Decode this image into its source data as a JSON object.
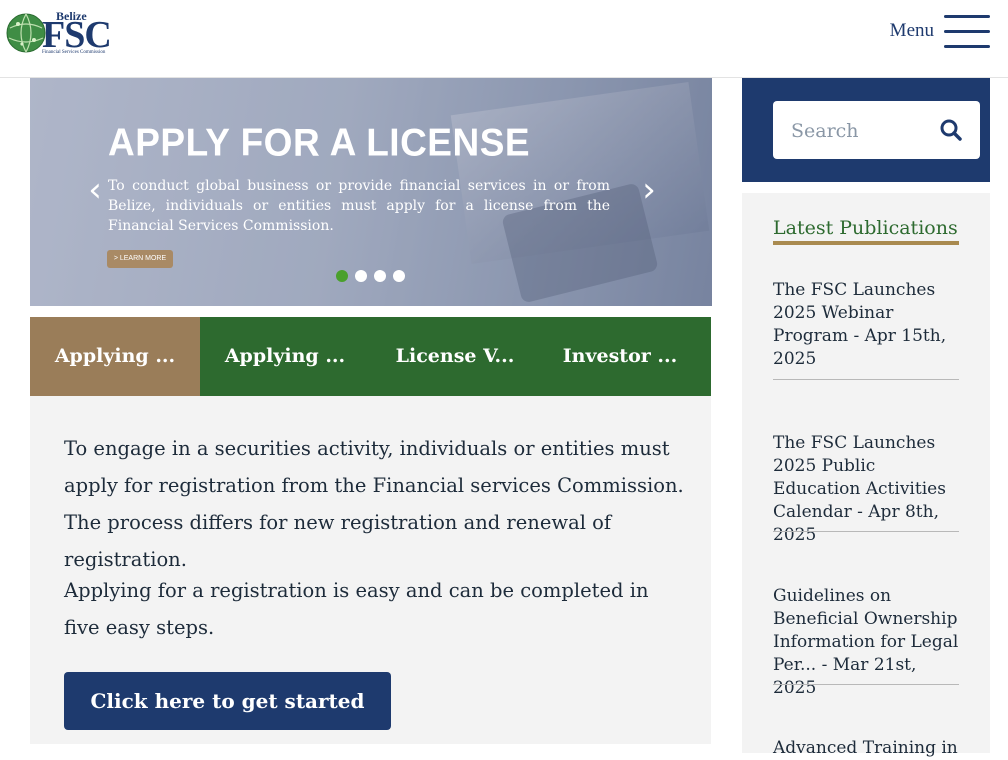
{
  "header": {
    "logo": {
      "top_text": "Belize",
      "main_text": "FSC",
      "tagline": "Financial Services Commission"
    },
    "menu_label": "Menu"
  },
  "slider": {
    "title": "APPLY FOR A LICENSE",
    "text": "To conduct global business or provide financial services in or from Belize, individuals or entities must apply for a license from the Financial Services Commission.",
    "button_label": "> LEARN MORE",
    "prev_arrow": "‹",
    "next_arrow": "›",
    "active_slide": 1,
    "slide_count": 4
  },
  "tabs": [
    {
      "label": "Applying ...",
      "active": true
    },
    {
      "label": "Applying ...",
      "active": false
    },
    {
      "label": "License V...",
      "active": false
    },
    {
      "label": "Investor ...",
      "active": false
    }
  ],
  "content": {
    "paragraph1": "To engage in a securities activity, individuals or entities must apply for registration from the Financial services Commission. The process differs for new registration and renewal of registration.",
    "paragraph2": "Applying for a registration is easy and can be completed in five easy steps.",
    "cta_label": "Click here to get started"
  },
  "sidebar": {
    "search": {
      "placeholder": "Search",
      "icon": "search-icon"
    },
    "publications": {
      "title": "Latest Publications",
      "items": [
        "The FSC Launches 2025 Webinar Program - Apr 15th, 2025",
        "The FSC Launches 2025 Public Education Activities Calendar - Apr 8th, 2025",
        "Guidelines on Beneficial Ownership Information for Legal Per... - Mar 21st, 2025",
        "Advanced Training in"
      ]
    }
  },
  "colors": {
    "navy": "#1e3a6e",
    "green": "#2d6a2f",
    "tan": "#9a7d59",
    "gold_underline": "#a98a4f",
    "dot_active": "#4aa02c"
  }
}
